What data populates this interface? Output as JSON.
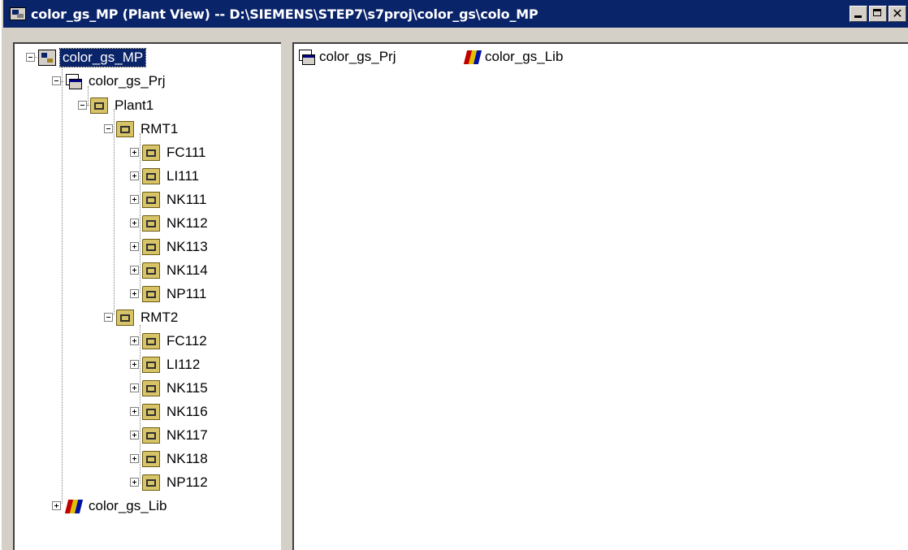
{
  "window": {
    "title": "color_gs_MP (Plant View) -- D:\\SIEMENS\\STEP7\\s7proj\\color_gs\\colo_MP",
    "close_glyph": "✕"
  },
  "tree": {
    "root": "color_gs_MP",
    "project": "color_gs_Prj",
    "plant": "Plant1",
    "rmt1": {
      "label": "RMT1",
      "children": [
        "FC111",
        "LI111",
        "NK111",
        "NK112",
        "NK113",
        "NK114",
        "NP111"
      ]
    },
    "rmt2": {
      "label": "RMT2",
      "children": [
        "FC112",
        "LI112",
        "NK115",
        "NK116",
        "NK117",
        "NK118",
        "NP112"
      ]
    },
    "library": "color_gs_Lib"
  },
  "content": {
    "items": [
      {
        "label": "color_gs_Prj",
        "icon": "project-icon"
      },
      {
        "label": "color_gs_Lib",
        "icon": "library-icon"
      }
    ]
  }
}
